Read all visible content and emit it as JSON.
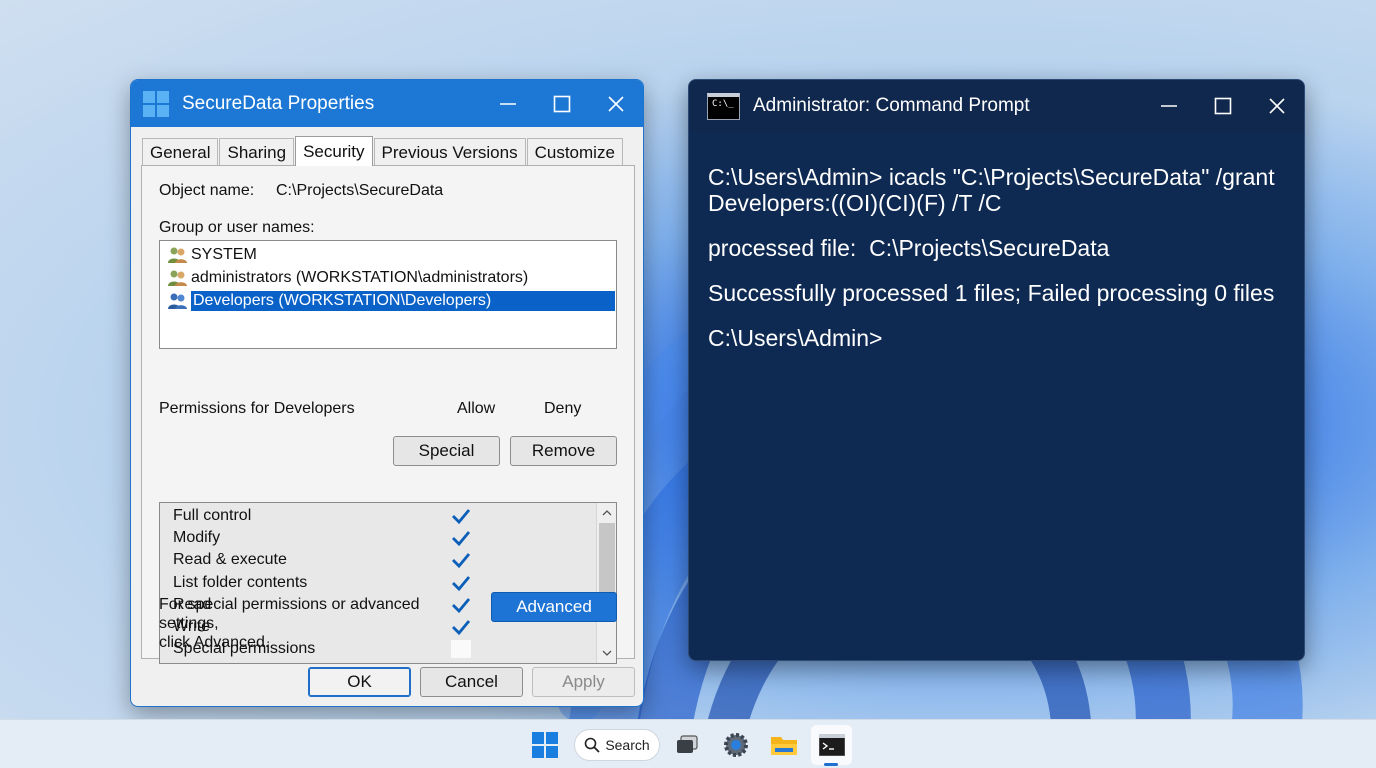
{
  "colors": {
    "accent": "#1c78d4",
    "selection": "#0a62c8",
    "cmd_background": "#0e2a52",
    "check": "#0b5fb8"
  },
  "properties_dialog": {
    "title": "SecureData Properties",
    "tabs": [
      {
        "label": "General",
        "active": false
      },
      {
        "label": "Sharing",
        "active": false
      },
      {
        "label": "Security",
        "active": true
      },
      {
        "label": "Previous Versions",
        "active": false
      },
      {
        "label": "Customize",
        "active": false
      }
    ],
    "object_name_label": "Object name:",
    "object_name_value": "C:\\Projects\\SecureData",
    "group_label": "Group or user names:",
    "users": [
      {
        "name": "SYSTEM",
        "icon": "user-group-icon",
        "selected": false
      },
      {
        "name": "administrators (WORKSTATION\\administrators)",
        "icon": "user-group-icon",
        "selected": false
      },
      {
        "name": "Developers (WORKSTATION\\Developers)",
        "icon": "user-group-icon",
        "selected": true
      }
    ],
    "special_button": "Special",
    "remove_button": "Remove",
    "permissions_label": "Permissions for Developers",
    "allow_header": "Allow",
    "deny_header": "Deny",
    "permissions": [
      {
        "name": "Full control",
        "allow": true
      },
      {
        "name": "Modify",
        "allow": true
      },
      {
        "name": "Read & execute",
        "allow": true
      },
      {
        "name": "List folder contents",
        "allow": true
      },
      {
        "name": "Read",
        "allow": true
      },
      {
        "name": "Write",
        "allow": true
      },
      {
        "name": "Special permissions",
        "allow": false
      }
    ],
    "advanced_text_1": "For special permissions or advanced settings,",
    "advanced_text_2": "click Advanced.",
    "advanced_button": "Advanced",
    "ok_button": "OK",
    "cancel_button": "Cancel",
    "apply_button": "Apply"
  },
  "command_prompt": {
    "title": "Administrator: Command Prompt",
    "icon_text": "C:\\_",
    "lines": [
      "C:\\Users\\Admin> icacls \"C:\\Projects\\SecureData\" /grant Developers:((OI)(CI)(F) /T /C",
      "processed file:  C:\\Projects\\SecureData",
      "Successfully processed 1 files; Failed processing 0 files",
      "C:\\Users\\Admin>"
    ]
  },
  "taskbar": {
    "search_label": "Search",
    "apps": [
      "start-icon",
      "task-view-icon",
      "settings-icon",
      "file-explorer-icon",
      "command-prompt-icon"
    ]
  }
}
